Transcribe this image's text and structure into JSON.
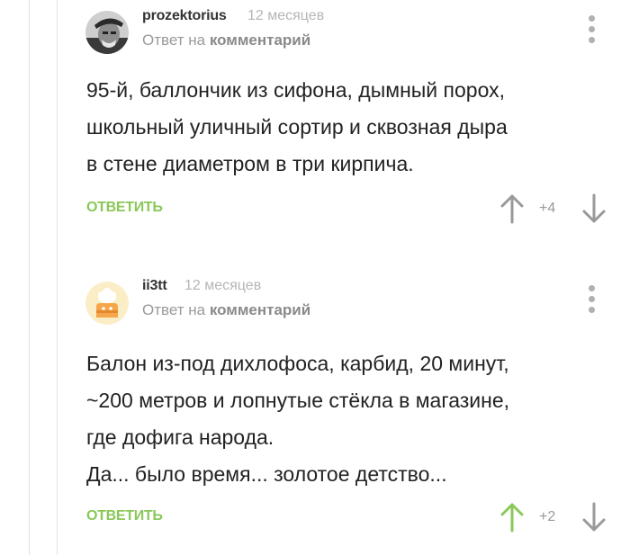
{
  "comments": [
    {
      "author": "prozektorius",
      "time": "12 месяцев",
      "reply_prefix": "Ответ на",
      "reply_target": "комментарий",
      "text": "95-й, баллончик из сифона, дымный порох,\nшкольный уличный сортир и сквозная дыра\nв стене  диаметром в три кирпича.",
      "reply_label": "ОТВЕТИТЬ",
      "rating": "+4",
      "upvoted": false
    },
    {
      "author": "ii3tt",
      "time": "12 месяцев",
      "reply_prefix": "Ответ на",
      "reply_target": "комментарий",
      "text": "Балон из-под дихлофоса, карбид, 20 минут,\n~200 метров и лопнутые стёкла в магазине,\nгде дофига народа.\nДа... было время... золотое детство...",
      "reply_label": "ОТВЕТИТЬ",
      "rating": "+2",
      "upvoted": true
    }
  ],
  "colors": {
    "accent_green": "#8ac858",
    "muted_gray": "#b0b0b0",
    "text": "#222222"
  },
  "icons": {
    "menu": "vertical-dots-icon",
    "up": "arrow-up-icon",
    "down": "arrow-down-icon"
  }
}
